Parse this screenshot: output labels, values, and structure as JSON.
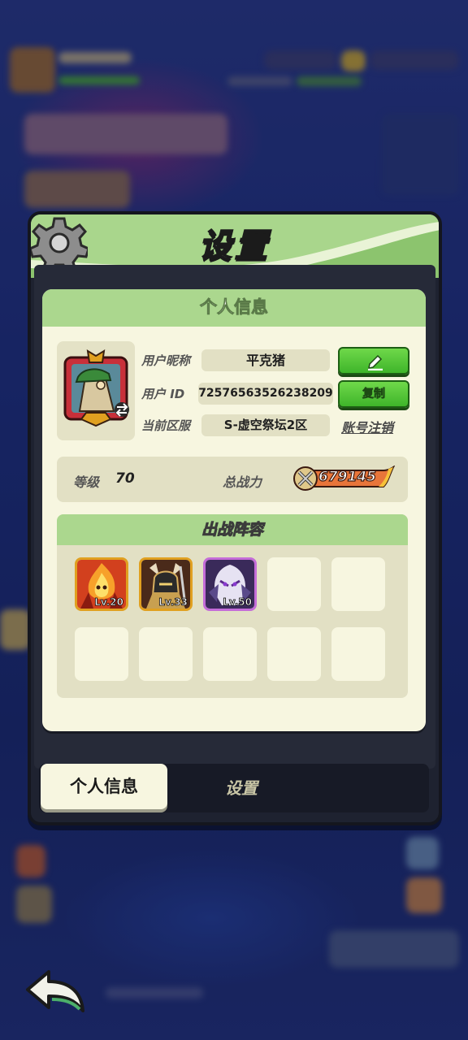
{
  "dialog": {
    "title": "设置"
  },
  "profile": {
    "header": "个人信息",
    "nickname_label": "用户昵称",
    "nickname": "平克猪",
    "id_label": "用户 ID",
    "user_id": "7257656352623820​9",
    "server_label": "当前区服",
    "server": "S-虚空祭坛2区",
    "copy_label": "复制",
    "logout_label": "账号注销",
    "edit_icon": "pencil-icon"
  },
  "stats": {
    "level_label": "等级",
    "level": "70",
    "power_label": "总战力",
    "power": "679145"
  },
  "lineup": {
    "header": "出战阵容",
    "heroes": [
      {
        "level": "Lv.20",
        "rarity_color": "#e0a020"
      },
      {
        "level": "Lv.33",
        "rarity_color": "#e0a020"
      },
      {
        "level": "Lv.50",
        "rarity_color": "#c46cd8"
      }
    ]
  },
  "tabs": {
    "active": "个人信息",
    "other": "设置"
  },
  "colors": {
    "accent_green": "#abd78e",
    "panel": "#f7f6e0",
    "button_green": "#3fb52a"
  }
}
